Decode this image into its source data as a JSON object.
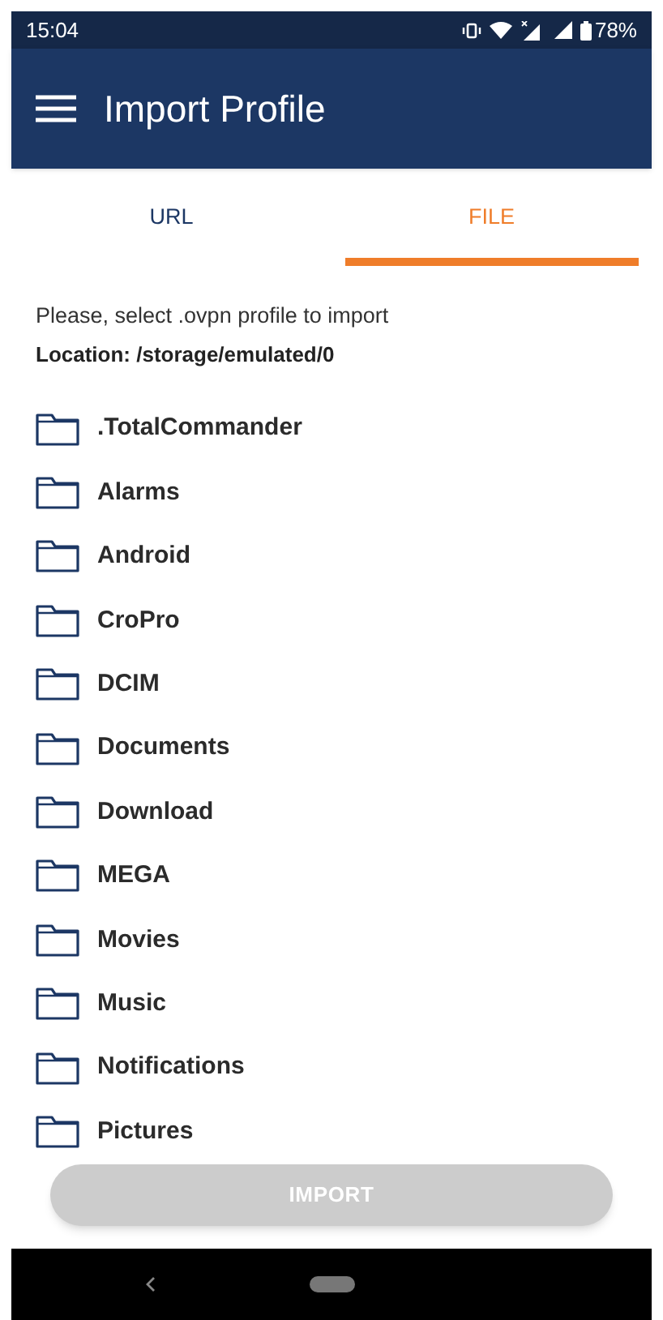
{
  "status_bar": {
    "time": "15:04",
    "battery": "78%"
  },
  "app_bar": {
    "title": "Import Profile"
  },
  "tabs": [
    {
      "label": "URL",
      "selected": false
    },
    {
      "label": "FILE",
      "selected": true
    }
  ],
  "instructions": "Please, select .ovpn profile to import",
  "location": "Location: /storage/emulated/0",
  "folders": [
    {
      "name": ".TotalCommander"
    },
    {
      "name": "Alarms"
    },
    {
      "name": "Android"
    },
    {
      "name": "CroPro"
    },
    {
      "name": "DCIM"
    },
    {
      "name": "Documents"
    },
    {
      "name": "Download"
    },
    {
      "name": "MEGA"
    },
    {
      "name": "Movies"
    },
    {
      "name": "Music"
    },
    {
      "name": "Notifications"
    },
    {
      "name": "Pictures"
    }
  ],
  "import_button": {
    "label": "IMPORT",
    "disabled": true
  }
}
